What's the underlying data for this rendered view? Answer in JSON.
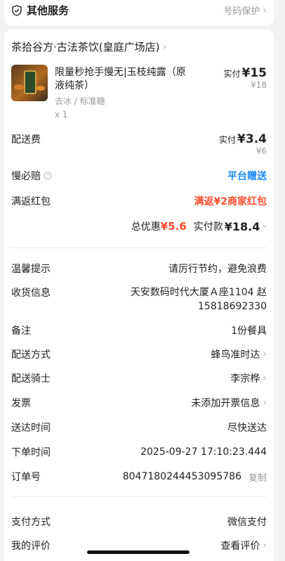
{
  "top_bar": {
    "title": "其他服务",
    "right_label": "号码保护",
    "icon": "shield-check-icon"
  },
  "store": {
    "name": "茶拾谷方·古法茶饮(皇庭广场店)"
  },
  "product": {
    "title_line1": "限量秒抢手慢无|玉枝纯露（原",
    "title_line2": "液纯茶）",
    "options": "去冰 / 标准糖",
    "qty": "x 1",
    "paid_label": "实付",
    "paid_price": "¥15",
    "original_price": "¥18",
    "image_icon": "tea-cup-image"
  },
  "fees": {
    "delivery_label": "配送费",
    "delivery_paid_label": "实付",
    "delivery_paid": "¥3.4",
    "delivery_original": "¥6",
    "slow_label": "慢必赔",
    "slow_value": "平台赠送",
    "redpack_label": "满返红包",
    "redpack_value": "满返¥2商家红包",
    "discount_label": "总优惠",
    "discount_value": "¥5.6",
    "total_label": "实付款",
    "total_value": "¥18.4"
  },
  "info": {
    "tip_label": "温馨提示",
    "tip_value": "请厉行节约，避免浪费",
    "address_label": "收货信息",
    "address_line1": "天安数码时代大厦Ａ座1104 赵",
    "address_line2": "15818692330",
    "note_label": "备注",
    "note_value": "1份餐具",
    "delivery_method_label": "配送方式",
    "delivery_method_value": "蜂鸟准时达",
    "rider_label": "配送骑士",
    "rider_value": "李宗桦",
    "invoice_label": "发票",
    "invoice_value": "未添加开票信息",
    "arrival_label": "送达时间",
    "arrival_value": "尽快送达",
    "order_time_label": "下单时间",
    "order_time_value": "2025-09-27 17:10:23.444",
    "order_no_label": "订单号",
    "order_no_value": "8047180244453095786",
    "copy_label": "复制",
    "pay_method_label": "支付方式",
    "pay_method_value": "微信支付",
    "review_label": "我的评价",
    "review_value": "查看评价"
  },
  "colors": {
    "accent_blue": "#1e8bf2",
    "accent_red": "#ff4d2d",
    "background": "#f2f2f2"
  }
}
